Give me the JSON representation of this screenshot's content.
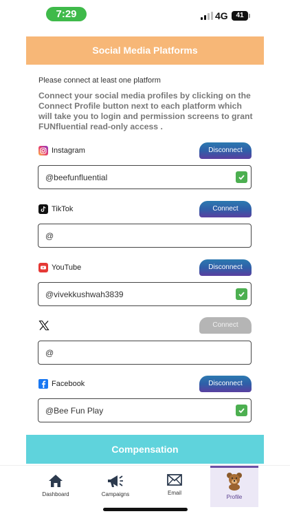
{
  "status_bar": {
    "time": "7:29",
    "network": "4G",
    "battery": "41"
  },
  "header": {
    "title": "Social Media Platforms"
  },
  "instructions": {
    "small": "Please connect at least one platform",
    "main": "Connect your social media profiles by clicking on the Connect Profile button next to each platform which will take you to login and permission screens to grant FUNfluential read-only access ."
  },
  "platforms": [
    {
      "name": "Instagram",
      "action": "Disconnect",
      "handle": "@beefunfluential",
      "connected": true,
      "icon": "instagram-icon"
    },
    {
      "name": "TikTok",
      "action": "Connect",
      "handle": "@",
      "connected": false,
      "icon": "tiktok-icon"
    },
    {
      "name": "YouTube",
      "action": "Disconnect",
      "handle": "@vivekkushwah3839",
      "connected": true,
      "icon": "youtube-icon"
    },
    {
      "name": "",
      "action": "Connect",
      "handle": "@",
      "connected": false,
      "icon": "x-icon",
      "disabled": true
    },
    {
      "name": "Facebook",
      "action": "Disconnect",
      "handle": "@Bee Fun Play",
      "connected": true,
      "icon": "facebook-icon"
    }
  ],
  "compensation": {
    "title": "Compensation"
  },
  "tabs": [
    {
      "label": "Dashboard",
      "icon": "home-icon"
    },
    {
      "label": "Campaigns",
      "icon": "megaphone-icon"
    },
    {
      "label": "Email",
      "icon": "envelope-icon"
    },
    {
      "label": "Profile",
      "icon": "bear-avatar-icon",
      "active": true
    }
  ],
  "colors": {
    "header": "#f7b777",
    "compensation": "#5fd3dc",
    "button_gradient_top": "#2c79b0",
    "button_gradient_bottom": "#5a3fa0",
    "check": "#4caf50",
    "time_pill": "#3fba4a"
  }
}
